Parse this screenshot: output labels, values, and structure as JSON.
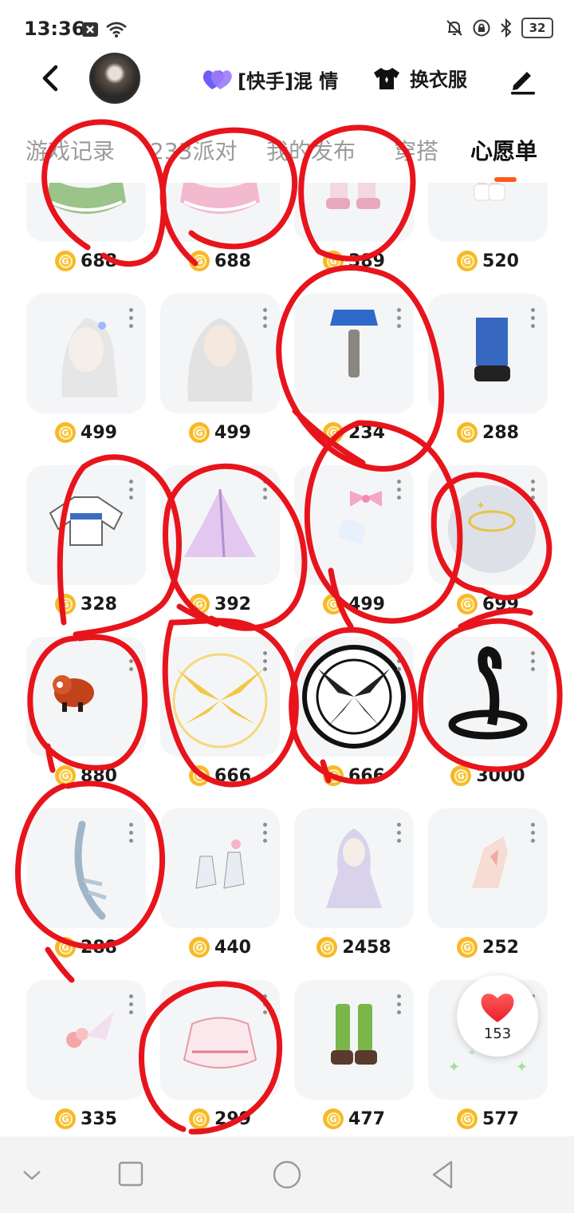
{
  "status_bar": {
    "time": "13:36",
    "battery": "32",
    "icons": [
      "close-box-icon",
      "wifi-icon",
      "bell-off-icon",
      "lock-rotation-icon",
      "bluetooth-icon"
    ]
  },
  "header": {
    "back_icon": "chevron-left-icon",
    "guild_label": "[快手]混 情",
    "guild_icon": "purple-heart-icon",
    "outfit_label": "换衣服",
    "outfit_icon": "shirt-icon",
    "edit_icon": "pencil-icon"
  },
  "tabs": [
    {
      "label": "游戏记录",
      "active": false
    },
    {
      "label": "233派对",
      "active": false
    },
    {
      "label": "我的发布",
      "active": false
    },
    {
      "label": "穿搭",
      "active": false
    },
    {
      "label": "心愿单",
      "active": true
    }
  ],
  "colors": {
    "accent": "#ff5a1f",
    "coin": "#f7b928",
    "annotation_red": "#e8141c",
    "card_bg": "#f4f5f7"
  },
  "items": [
    {
      "name": "green-ruffle-skirt",
      "price": "688"
    },
    {
      "name": "pink-ruffle-skirt",
      "price": "688"
    },
    {
      "name": "pink-boots",
      "price": "389"
    },
    {
      "name": "white-socks",
      "price": "520"
    },
    {
      "name": "silver-long-hair-bow",
      "price": "499"
    },
    {
      "name": "silver-wavy-hair",
      "price": "499"
    },
    {
      "name": "blue-skirt-leg-strap",
      "price": "234"
    },
    {
      "name": "blue-boots",
      "price": "288"
    },
    {
      "name": "white-crop-jacket",
      "price": "328"
    },
    {
      "name": "purple-gown",
      "price": "392"
    },
    {
      "name": "pink-bow-gloves",
      "price": "499"
    },
    {
      "name": "star-halo-smoke",
      "price": "699"
    },
    {
      "name": "red-panda-pet",
      "price": "880"
    },
    {
      "name": "golden-wings-circle",
      "price": "666"
    },
    {
      "name": "black-rune-circle",
      "price": "666"
    },
    {
      "name": "black-cobra-pet",
      "price": "3000"
    },
    {
      "name": "ice-tail",
      "price": "288"
    },
    {
      "name": "crystal-heels",
      "price": "440"
    },
    {
      "name": "lavender-twin-hair",
      "price": "2458"
    },
    {
      "name": "hand-tattoo",
      "price": "252"
    },
    {
      "name": "rose-hairpin",
      "price": "335"
    },
    {
      "name": "pink-tutu-dress",
      "price": "299"
    },
    {
      "name": "green-leather-boots",
      "price": "477"
    },
    {
      "name": "green-sparkle-effect",
      "price": "577"
    }
  ],
  "like_button": {
    "count": "153",
    "icon": "heart-icon"
  },
  "navbar": {
    "icons": [
      "chevron-down-icon",
      "square-icon",
      "circle-icon",
      "triangle-back-icon"
    ]
  }
}
